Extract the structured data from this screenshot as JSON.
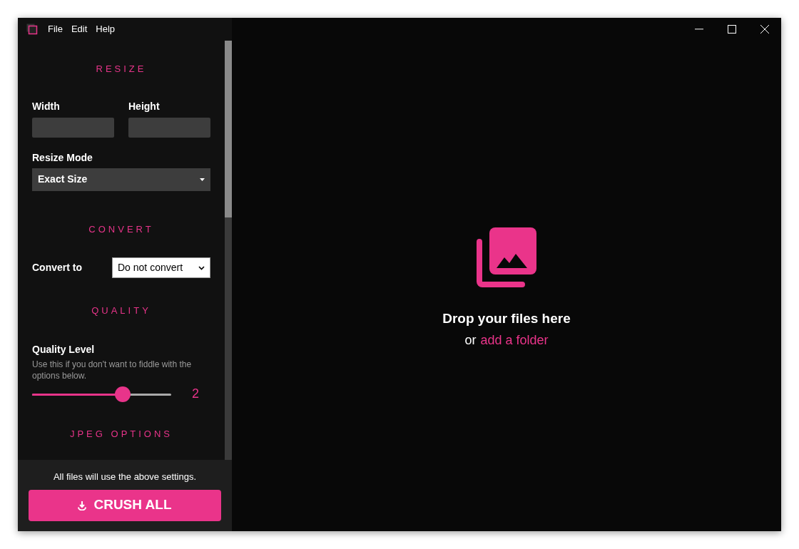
{
  "menu": [
    "File",
    "Edit",
    "Help"
  ],
  "resize": {
    "heading": "RESIZE",
    "width_label": "Width",
    "height_label": "Height",
    "mode_label": "Resize Mode",
    "mode_value": "Exact Size"
  },
  "convert": {
    "heading": "CONVERT",
    "label": "Convert to",
    "value": "Do not convert"
  },
  "quality": {
    "heading": "QUALITY",
    "label": "Quality Level",
    "hint": "Use this if you don't want to fiddle with the options below.",
    "level": 0.65,
    "reading": "2"
  },
  "jpeg": {
    "heading": "JPEG OPTIONS"
  },
  "footer": {
    "note": "All files will use the above settings.",
    "button": "CRUSH ALL"
  },
  "dropzone": {
    "title": "Drop your files here",
    "prefix": "or",
    "link": "add a folder"
  }
}
